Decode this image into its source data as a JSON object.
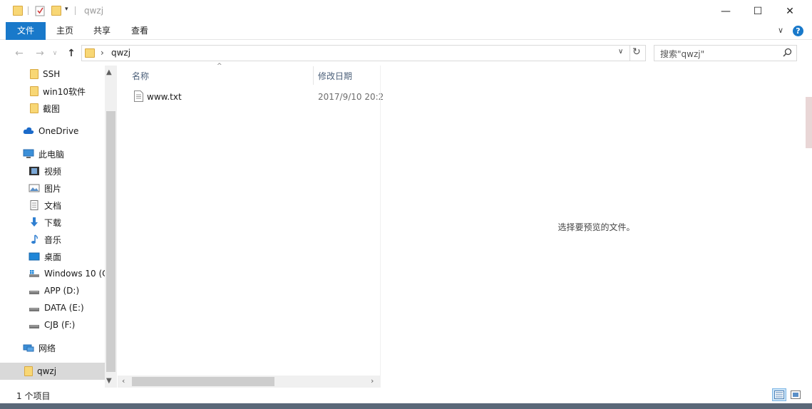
{
  "window": {
    "title": "qwzj",
    "minimize_glyph": "—",
    "maximize_glyph": "☐",
    "close_glyph": "✕"
  },
  "ribbon": {
    "tabs": [
      {
        "label": "文件",
        "active": true
      },
      {
        "label": "主页"
      },
      {
        "label": "共享"
      },
      {
        "label": "查看"
      }
    ],
    "collapse_glyph": "∨",
    "help_glyph": "?"
  },
  "address": {
    "back_glyph": "←",
    "forward_glyph": "→",
    "recent_glyph": "∨",
    "up_glyph": "↑",
    "separator": "›",
    "path": "qwzj",
    "dropdown_glyph": "∨",
    "refresh_glyph": "↻"
  },
  "search": {
    "placeholder": "搜索\"qwzj\"",
    "icon": "search-icon"
  },
  "nav": {
    "items": [
      {
        "label": "SSH",
        "icon": "folder-icon"
      },
      {
        "label": "win10软件",
        "icon": "folder-icon"
      },
      {
        "label": "截图",
        "icon": "folder-icon"
      },
      {
        "label": "OneDrive",
        "icon": "cloud-icon"
      },
      {
        "label": "此电脑",
        "icon": "computer-icon"
      },
      {
        "label": "视频",
        "icon": "video-icon"
      },
      {
        "label": "图片",
        "icon": "picture-icon"
      },
      {
        "label": "文档",
        "icon": "document-icon"
      },
      {
        "label": "下载",
        "icon": "download-icon"
      },
      {
        "label": "音乐",
        "icon": "music-icon"
      },
      {
        "label": "桌面",
        "icon": "desktop-icon"
      },
      {
        "label": "Windows 10 (C",
        "icon": "windows-drive-icon"
      },
      {
        "label": "APP (D:)",
        "icon": "drive-icon"
      },
      {
        "label": "DATA (E:)",
        "icon": "drive-icon"
      },
      {
        "label": "CJB (F:)",
        "icon": "drive-icon"
      },
      {
        "label": "网络",
        "icon": "network-icon"
      },
      {
        "label": "qwzj",
        "icon": "folder-icon",
        "selected": true
      }
    ]
  },
  "filelist": {
    "columns": [
      "名称",
      "修改日期"
    ],
    "sort_glyph": "^",
    "rows": [
      {
        "name": "www.txt",
        "modified": "2017/9/10 20:2"
      }
    ]
  },
  "preview": {
    "message": "选择要预览的文件。"
  },
  "status": {
    "count": "1 个项目"
  }
}
